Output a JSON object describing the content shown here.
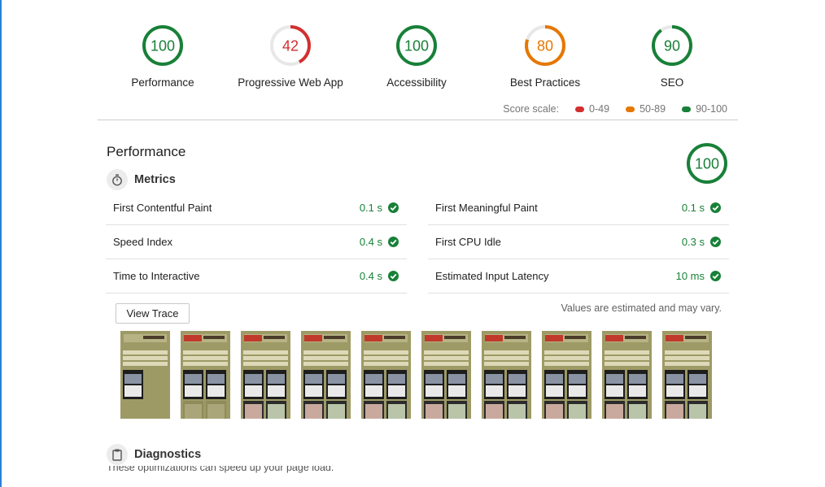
{
  "colors": {
    "pass": "#188038",
    "average": "#e67700",
    "fail": "#d32f2f",
    "track": "#e8e8e8"
  },
  "categories": [
    {
      "score": "100",
      "score_fraction": 1.0,
      "label": "Performance",
      "status": "pass"
    },
    {
      "score": "42",
      "score_fraction": 0.42,
      "label": "Progressive Web App",
      "status": "fail"
    },
    {
      "score": "100",
      "score_fraction": 1.0,
      "label": "Accessibility",
      "status": "pass"
    },
    {
      "score": "80",
      "score_fraction": 0.8,
      "label": "Best Practices",
      "status": "average"
    },
    {
      "score": "90",
      "score_fraction": 0.9,
      "label": "SEO",
      "status": "pass"
    }
  ],
  "score_scale": {
    "label": "Score scale:",
    "ranges": [
      {
        "label": "0-49",
        "color": "#d32f2f"
      },
      {
        "label": "50-89",
        "color": "#e67700"
      },
      {
        "label": "90-100",
        "color": "#188038"
      }
    ]
  },
  "performance": {
    "title": "Performance",
    "score": "100",
    "score_fraction": 1.0,
    "metrics_title": "Metrics",
    "metrics_icon": "stopwatch-icon",
    "metrics_left": [
      {
        "name": "First Contentful Paint",
        "value": "0.1 s"
      },
      {
        "name": "Speed Index",
        "value": "0.4 s"
      },
      {
        "name": "Time to Interactive",
        "value": "0.4 s"
      }
    ],
    "metrics_right": [
      {
        "name": "First Meaningful Paint",
        "value": "0.1 s"
      },
      {
        "name": "First CPU Idle",
        "value": "0.3 s"
      },
      {
        "name": "Estimated Input Latency",
        "value": "10 ms"
      }
    ],
    "view_trace_label": "View Trace",
    "estimate_note": "Values are estimated and may vary.",
    "filmstrip_frames": 10
  },
  "diagnostics": {
    "title": "Diagnostics",
    "icon": "clipboard-icon",
    "subtitle": "These optimizations can speed up your page load."
  }
}
